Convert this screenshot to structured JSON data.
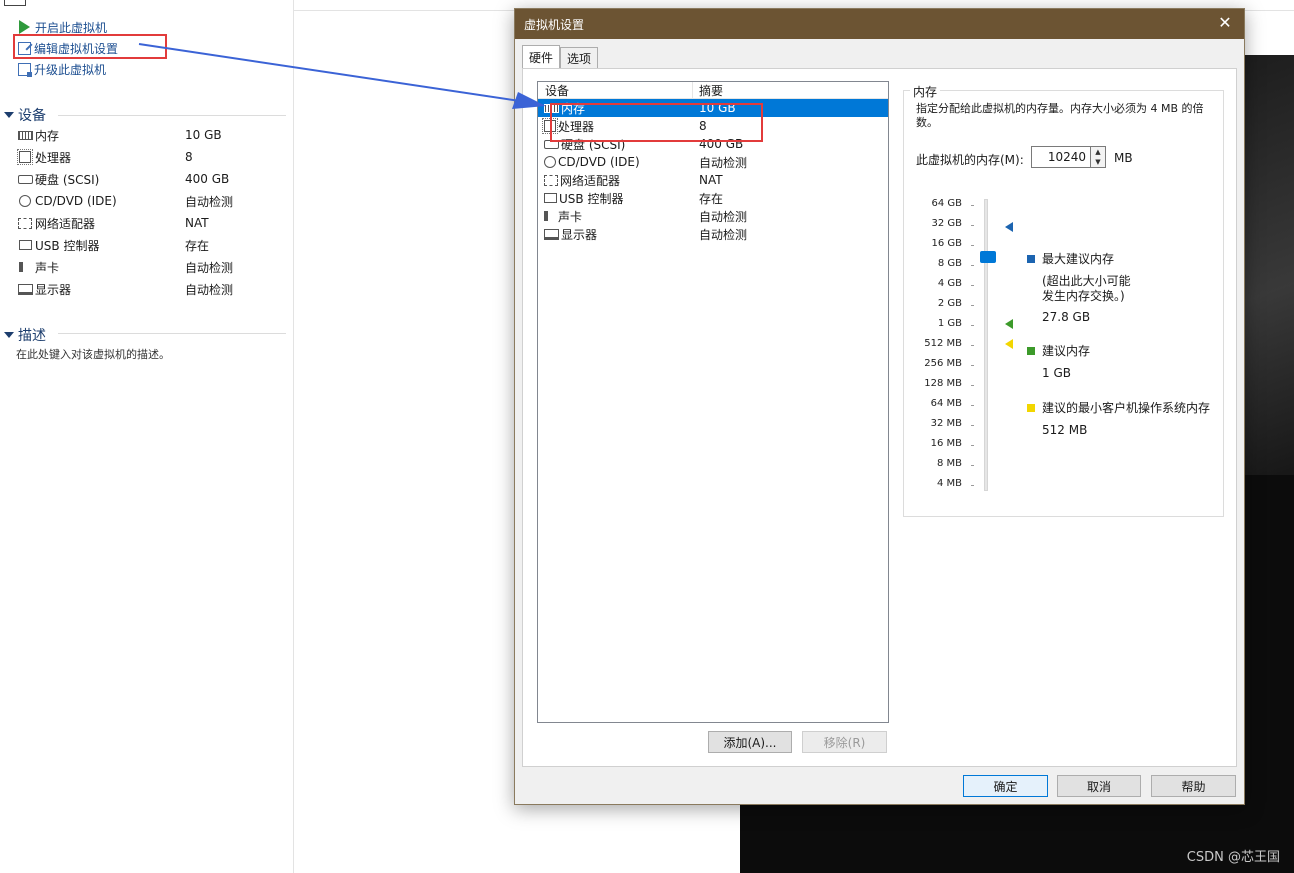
{
  "left_panel": {
    "actions": [
      {
        "label": "开启此虚拟机",
        "icon": "play-icon"
      },
      {
        "label": "编辑虚拟机设置",
        "icon": "edit-settings-icon"
      },
      {
        "label": "升级此虚拟机",
        "icon": "upgrade-icon"
      }
    ],
    "devices_title": "设备",
    "devices": [
      {
        "name": "内存",
        "value": "10 GB",
        "icon": "memory-icon"
      },
      {
        "name": "处理器",
        "value": "8",
        "icon": "processor-icon"
      },
      {
        "name": "硬盘 (SCSI)",
        "value": "400 GB",
        "icon": "hard-disk-icon"
      },
      {
        "name": "CD/DVD (IDE)",
        "value": "自动检测",
        "icon": "cd-dvd-icon"
      },
      {
        "name": "网络适配器",
        "value": "NAT",
        "icon": "network-adapter-icon"
      },
      {
        "name": "USB 控制器",
        "value": "存在",
        "icon": "usb-icon"
      },
      {
        "name": "声卡",
        "value": "自动检测",
        "icon": "sound-card-icon"
      },
      {
        "name": "显示器",
        "value": "自动检测",
        "icon": "monitor-icon"
      }
    ],
    "description_title": "描述",
    "description_placeholder": "在此处键入对该虚拟机的描述。"
  },
  "dialog": {
    "title": "虚拟机设置",
    "tabs": [
      {
        "label": "硬件",
        "active": true
      },
      {
        "label": "选项",
        "active": false
      }
    ],
    "device_list": {
      "col_device": "设备",
      "col_summary": "摘要",
      "rows": [
        {
          "device": "内存",
          "summary": "10 GB",
          "selected": true
        },
        {
          "device": "处理器",
          "summary": "8"
        },
        {
          "device": "硬盘 (SCSI)",
          "summary": "400 GB"
        },
        {
          "device": "CD/DVD (IDE)",
          "summary": "自动检测"
        },
        {
          "device": "网络适配器",
          "summary": "NAT"
        },
        {
          "device": "USB 控制器",
          "summary": "存在"
        },
        {
          "device": "声卡",
          "summary": "自动检测"
        },
        {
          "device": "显示器",
          "summary": "自动检测"
        }
      ]
    },
    "add_button": "添加(A)...",
    "remove_button": "移除(R)",
    "memory": {
      "group_title": "内存",
      "hint": "指定分配给此虚拟机的内存量。内存大小必须为 4 MB 的倍数。",
      "field_label": "此虚拟机的内存(M):",
      "field_value": "10240",
      "unit": "MB",
      "scale": [
        "64 GB",
        "32 GB",
        "16 GB",
        "8 GB",
        "4 GB",
        "2 GB",
        "1 GB",
        "512 MB",
        "256 MB",
        "128 MB",
        "64 MB",
        "32 MB",
        "16 MB",
        "8 MB",
        "4 MB"
      ],
      "legend": {
        "max_title": "最大建议内存",
        "max_note": "(超出此大小可能\n发生内存交换。)",
        "max_value": "27.8 GB",
        "rec_title": "建议内存",
        "rec_value": "1 GB",
        "min_title": "建议的最小客户机操作系统内存",
        "min_value": "512 MB"
      },
      "colors": {
        "max": "#1c64b0",
        "rec": "#3c9a2a",
        "min": "#f2d600"
      }
    },
    "ok_button": "确定",
    "cancel_button": "取消",
    "help_button": "帮助"
  },
  "watermark": "CSDN @芯王国"
}
